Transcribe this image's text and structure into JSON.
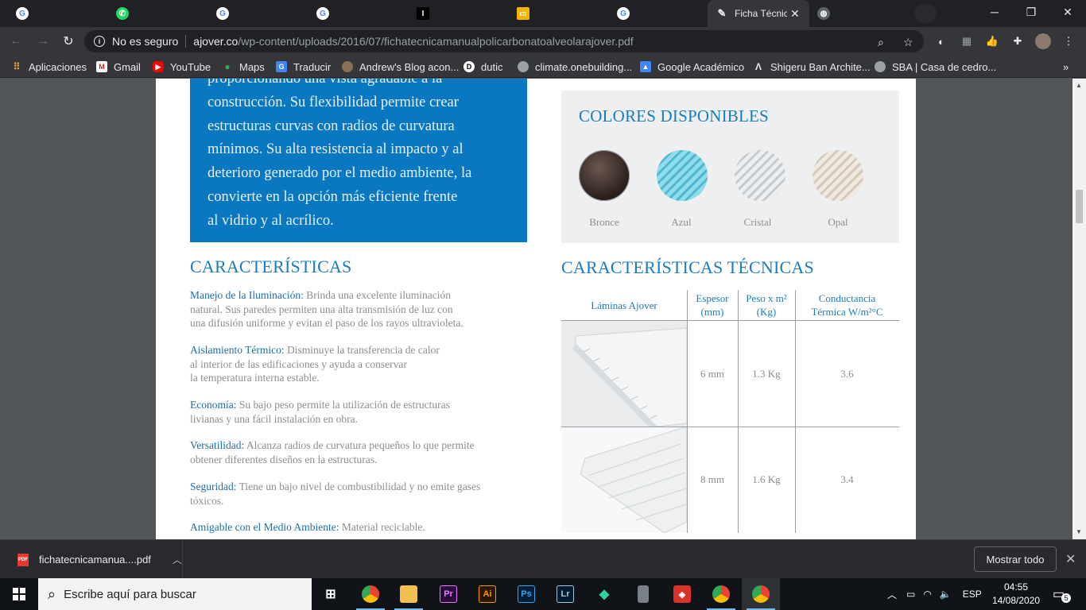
{
  "browser": {
    "tabs": [
      {
        "icon": "google-icon",
        "label": ""
      },
      {
        "icon": "whatsapp-icon",
        "label": ""
      },
      {
        "icon": "google-icon",
        "label": ""
      },
      {
        "icon": "google-icon",
        "label": ""
      },
      {
        "icon": "instapaper-icon",
        "label": "I"
      },
      {
        "icon": "slides-icon",
        "label": ""
      },
      {
        "icon": "google-icon",
        "label": ""
      }
    ],
    "active_tab": {
      "title": "Ficha Técnic",
      "close": "✕"
    },
    "inactive_tab_icon": "globe-icon",
    "window_controls": {
      "minimize": "─",
      "maximize": "❐",
      "close": "✕"
    },
    "security_label": "No es seguro",
    "url_host": "ajover.co",
    "url_path": "/wp-content/uploads/2016/07/fichatecnicamanualpolicarbonatoalveolarajover.pdf",
    "bookmarks": [
      {
        "label": "Aplicaciones",
        "icon": "apps-grid-icon",
        "color": "#e8a33d"
      },
      {
        "label": "Gmail",
        "icon": "gmail-icon",
        "color": "#d93025"
      },
      {
        "label": "YouTube",
        "icon": "youtube-icon",
        "color": "#ff0000"
      },
      {
        "label": "Maps",
        "icon": "maps-pin-icon",
        "color": "#34a853"
      },
      {
        "label": "Traducir",
        "icon": "translate-icon",
        "color": "#4285f4"
      },
      {
        "label": "Andrew's Blog acon...",
        "icon": "avatar-icon",
        "color": "#8a6f5a"
      },
      {
        "label": "dutic",
        "icon": "dutic-icon",
        "color": "#ffffff"
      },
      {
        "label": "climate.onebuilding...",
        "icon": "globe-icon",
        "color": "#9aa0a6"
      },
      {
        "label": "Google Académico",
        "icon": "scholar-icon",
        "color": "#4285f4"
      },
      {
        "label": "Shigeru Ban Archite...",
        "icon": "archdaily-icon",
        "color": "#e8eaed"
      },
      {
        "label": "SBA | Casa de cedro...",
        "icon": "globe-icon",
        "color": "#9aa0a6"
      }
    ],
    "more_bookmarks": "»"
  },
  "pdf": {
    "intro_text": "proporcionando una vista agradable a la construcción. Su flexibilidad permite crear estructuras curvas con radios de curvatura mínimos. Su alta resistencia al impacto y al deterioro generado por el medio ambiente, la convierte  en la opción más eficiente frente al vidrio y al acrílico.",
    "intro_lines": [
      "proporcionando una vista agradable a la",
      "construcción. Su flexibilidad permite crear",
      "estructuras curvas con radios de curvatura",
      "mínimos. Su alta resistencia al impacto y al",
      "deterioro generado por el medio ambiente, la",
      "convierte  en la opción más eficiente frente",
      "al vidrio y al acrílico."
    ],
    "characteristics_title": "CARACTERÍSTICAS",
    "features": [
      {
        "label": "Manejo de la Iluminación:",
        "lines": [
          " Brinda una excelente iluminación",
          "natural. Sus paredes permiten una alta transmisión de luz con",
          "una difusión uniforme y evitan el paso de los rayos ultravioleta."
        ]
      },
      {
        "label": "Aislamiento Térmico:",
        "lines": [
          " Disminuye la transferencia de calor",
          "al interior de las edificaciones y ayuda a conservar",
          "la temperatura interna estable."
        ]
      },
      {
        "label": "Economía:",
        "lines": [
          " Su bajo peso permite la utilización de estructuras",
          "livianas y una fácil instalación en obra."
        ]
      },
      {
        "label": "Versatilidad:",
        "lines": [
          " Alcanza radios de curvatura pequeños lo que permite",
          "obtener diferentes diseños en la estructuras."
        ]
      },
      {
        "label": "Seguridad:",
        "lines": [
          " Tiene un bajo nivel de combustibilidad y no emite gases",
          "tóxicos."
        ]
      },
      {
        "label": "Amigable con el Medio Ambiente:",
        "lines": [
          " Material reciclable."
        ]
      }
    ],
    "colors_title": "COLORES DISPONIBLES",
    "colors": [
      {
        "name": "Bronce",
        "color": "#3a2c27"
      },
      {
        "name": "Azul",
        "color": "#6fcde0"
      },
      {
        "name": "Cristal",
        "color": "#d8dadb"
      },
      {
        "name": "Opal",
        "color": "#e2dbd0"
      }
    ],
    "tech_title": "CARACTERÍSTICAS TÉCNICAS",
    "table": {
      "headers": [
        "Láminas Ajover",
        "Espesor\n(mm)",
        "Peso x m²\n(Kg)",
        "Conductancia\nTérmica W/m²°C"
      ],
      "rows": [
        [
          "6 mm",
          "1.3 Kg",
          "3.6"
        ],
        [
          "8 mm",
          "1.6 Kg",
          "3.4"
        ]
      ]
    }
  },
  "downloads": {
    "file_name": "fichatecnicamanua....pdf",
    "file_badge": "PDF",
    "show_all": "Mostrar todo",
    "close": "✕"
  },
  "taskbar": {
    "search_placeholder": "Escribe aquí para buscar",
    "apps": [
      {
        "icon": "task-view-icon",
        "label": "⊞"
      },
      {
        "icon": "chrome-icon",
        "label": ""
      },
      {
        "icon": "file-explorer-icon",
        "label": ""
      },
      {
        "icon": "premiere-icon",
        "label": "Pr"
      },
      {
        "icon": "illustrator-icon",
        "label": "Ai"
      },
      {
        "icon": "photoshop-icon",
        "label": "Ps"
      },
      {
        "icon": "lightroom-icon",
        "label": "Lr"
      },
      {
        "icon": "sourcetree-icon",
        "label": ""
      },
      {
        "icon": "archive-icon",
        "label": ""
      },
      {
        "icon": "sketchup-icon",
        "label": ""
      },
      {
        "icon": "chrome-icon",
        "label": ""
      },
      {
        "icon": "chrome-icon",
        "label": ""
      }
    ],
    "language": "ESP",
    "time": "04:55",
    "date": "14/08/2020",
    "notifications": "5"
  }
}
